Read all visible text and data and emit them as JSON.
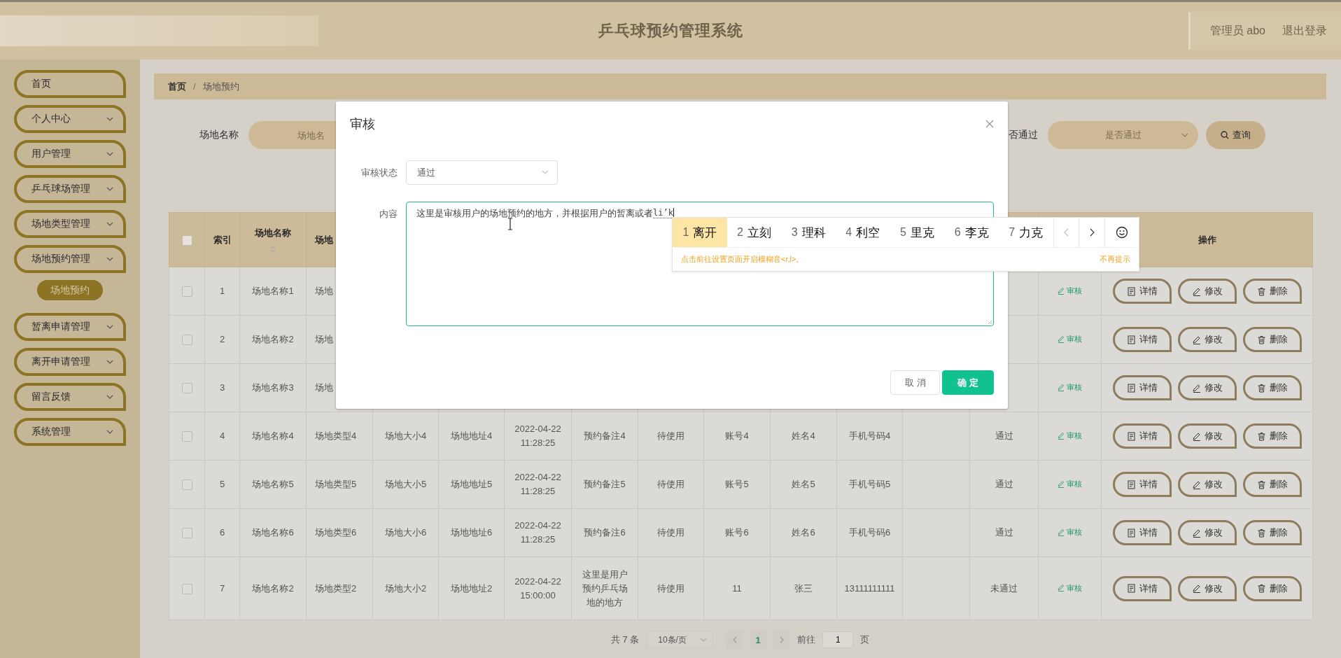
{
  "header": {
    "title": "乒乓球预约管理系统",
    "user": "管理员 abo",
    "logout": "退出登录"
  },
  "sidebar": {
    "items": [
      {
        "kind": "link",
        "label": "首页"
      },
      {
        "kind": "menu",
        "label": "个人中心"
      },
      {
        "kind": "menu",
        "label": "用户管理"
      },
      {
        "kind": "menu",
        "label": "乒乓球场管理"
      },
      {
        "kind": "menu",
        "label": "场地类型管理"
      },
      {
        "kind": "menu",
        "label": "场地预约管理",
        "children": [
          {
            "label": "场地预约",
            "selected": true
          }
        ]
      },
      {
        "kind": "menu",
        "label": "暂离申请管理"
      },
      {
        "kind": "menu",
        "label": "离开申请管理"
      },
      {
        "kind": "menu",
        "label": "留言反馈"
      },
      {
        "kind": "menu",
        "label": "系统管理"
      }
    ]
  },
  "breadcrumb": {
    "items": [
      "首页",
      "场地预约"
    ],
    "separator": "/"
  },
  "search": {
    "name_label": "场地名称",
    "name_placeholder": "场地名",
    "status_label": "否通过",
    "status_placeholder": "是否通过",
    "button": "查询"
  },
  "table": {
    "select_all": {
      "checked": false
    },
    "columns": [
      {
        "label": "索引",
        "sortable": false
      },
      {
        "label": "场地名称",
        "sortable": true
      },
      {
        "label": "场地",
        "sortable": false
      },
      null,
      null,
      null,
      null,
      null,
      null,
      null,
      null,
      null,
      null,
      null,
      {
        "label": "操作",
        "sortable": false
      }
    ],
    "rows": [
      {
        "checked": false,
        "cells": [
          "1",
          "场地名称1",
          "场地",
          null,
          null,
          null,
          null,
          null,
          null,
          null,
          null,
          null,
          null
        ],
        "review": "审核",
        "actions": [
          {
            "kind": "detail",
            "label": "详情"
          },
          {
            "kind": "edit",
            "label": "修改"
          },
          {
            "kind": "delete",
            "label": "删除"
          }
        ]
      },
      {
        "checked": false,
        "cells": [
          "2",
          "场地名称2",
          "场地",
          null,
          null,
          null,
          null,
          null,
          null,
          null,
          null,
          null,
          null
        ],
        "review": "审核",
        "actions": [
          {
            "kind": "detail",
            "label": "详情"
          },
          {
            "kind": "edit",
            "label": "修改"
          },
          {
            "kind": "delete",
            "label": "删除"
          }
        ]
      },
      {
        "checked": false,
        "cells": [
          "3",
          "场地名称3",
          "场地",
          null,
          null,
          null,
          null,
          null,
          null,
          null,
          null,
          null,
          null
        ],
        "review": "审核",
        "actions": [
          {
            "kind": "detail",
            "label": "详情"
          },
          {
            "kind": "edit",
            "label": "修改"
          },
          {
            "kind": "delete",
            "label": "删除"
          }
        ]
      },
      {
        "checked": false,
        "cells": [
          "4",
          "场地名称4",
          "场地类型4",
          "场地大小4",
          "场地地址4",
          "2022-04-22 11:28:25",
          "预约备注4",
          "待使用",
          "账号4",
          "姓名4",
          "手机号码4",
          null,
          "通过"
        ],
        "review": "审核",
        "actions": [
          {
            "kind": "detail",
            "label": "详情"
          },
          {
            "kind": "edit",
            "label": "修改"
          },
          {
            "kind": "delete",
            "label": "删除"
          }
        ]
      },
      {
        "checked": false,
        "cells": [
          "5",
          "场地名称5",
          "场地类型5",
          "场地大小5",
          "场地地址5",
          "2022-04-22 11:28:25",
          "预约备注5",
          "待使用",
          "账号5",
          "姓名5",
          "手机号码5",
          null,
          "通过"
        ],
        "review": "审核",
        "actions": [
          {
            "kind": "detail",
            "label": "详情"
          },
          {
            "kind": "edit",
            "label": "修改"
          },
          {
            "kind": "delete",
            "label": "删除"
          }
        ]
      },
      {
        "checked": false,
        "cells": [
          "6",
          "场地名称6",
          "场地类型6",
          "场地大小6",
          "场地地址6",
          "2022-04-22 11:28:25",
          "预约备注6",
          "待使用",
          "账号6",
          "姓名6",
          "手机号码6",
          null,
          "通过"
        ],
        "review": "审核",
        "actions": [
          {
            "kind": "detail",
            "label": "详情"
          },
          {
            "kind": "edit",
            "label": "修改"
          },
          {
            "kind": "delete",
            "label": "删除"
          }
        ]
      },
      {
        "checked": false,
        "cells": [
          "7",
          "场地名称2",
          "场地类型2",
          "场地大小2",
          "场地地址2",
          "2022-04-22 15:00:00",
          "这里是用户预约乒乓场地的地方",
          "待使用",
          "11",
          "张三",
          "13111111111",
          null,
          "未通过"
        ],
        "review": "审核",
        "actions": [
          {
            "kind": "detail",
            "label": "详情"
          },
          {
            "kind": "edit",
            "label": "修改"
          },
          {
            "kind": "delete",
            "label": "删除"
          }
        ]
      }
    ]
  },
  "pagination": {
    "total": "共 7 条",
    "page_size": "10条/页",
    "pages": [
      {
        "label": "1",
        "selected": true
      }
    ],
    "goto_label": "前往",
    "goto_value": "1",
    "goto_suffix": "页"
  },
  "dialog": {
    "title": "审核",
    "fields": [
      {
        "kind": "select",
        "label": "审核状态",
        "value": "通过"
      },
      {
        "kind": "textarea",
        "label": "内容",
        "value": "这里是审核用户的场地预约的地方，并根据用户的暂离或者",
        "composition": "li’k"
      }
    ],
    "buttons": [
      {
        "kind": "cancel",
        "label": "取消"
      },
      {
        "kind": "primary",
        "label": "确定"
      }
    ]
  },
  "ime": {
    "candidates": [
      {
        "number": "1",
        "text": "离开",
        "selected": true
      },
      {
        "number": "2",
        "text": "立刻",
        "selected": false
      },
      {
        "number": "3",
        "text": "理科",
        "selected": false
      },
      {
        "number": "4",
        "text": "利空",
        "selected": false
      },
      {
        "number": "5",
        "text": "里克",
        "selected": false
      },
      {
        "number": "6",
        "text": "李克",
        "selected": false
      },
      {
        "number": "7",
        "text": "力克",
        "selected": false
      }
    ],
    "hint": "点击前往设置页面开启模糊音<r,l>。",
    "dismiss": "不再提示"
  }
}
